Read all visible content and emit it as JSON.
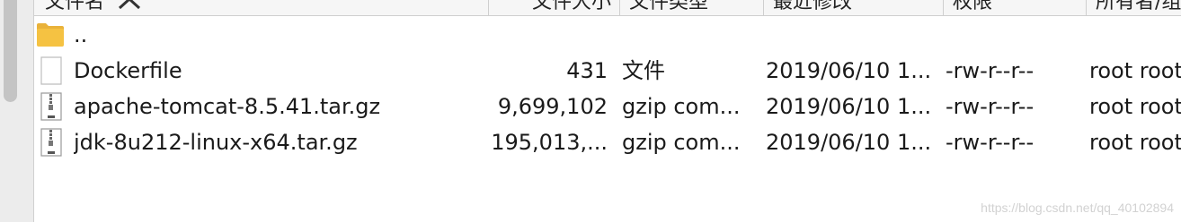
{
  "columns": {
    "name": "文件名",
    "size": "文件大小",
    "type": "文件类型",
    "modified": "最近修改",
    "permissions": "权限",
    "owner": "所有者/组"
  },
  "files": [
    {
      "icon": "folder-icon",
      "name": "..",
      "size": "",
      "type": "",
      "modified": "",
      "permissions": "",
      "owner": ""
    },
    {
      "icon": "document-icon",
      "name": "Dockerfile",
      "size": "431",
      "type": "文件",
      "modified": "2019/06/10 1...",
      "permissions": "-rw-r--r--",
      "owner": "root root"
    },
    {
      "icon": "archive-icon",
      "name": "apache-tomcat-8.5.41.tar.gz",
      "size": "9,699,102",
      "type": "gzip com...",
      "modified": "2019/06/10 1...",
      "permissions": "-rw-r--r--",
      "owner": "root root"
    },
    {
      "icon": "archive-icon",
      "name": "jdk-8u212-linux-x64.tar.gz",
      "size": "195,013,...",
      "type": "gzip com...",
      "modified": "2019/06/10 1...",
      "permissions": "-rw-r--r--",
      "owner": "root root"
    }
  ],
  "watermark": "https://blog.csdn.net/qq_40102894",
  "colors": {
    "folder": "#f5c242",
    "text": "#1a1a1a",
    "header_bg": "#f6f6f6"
  }
}
